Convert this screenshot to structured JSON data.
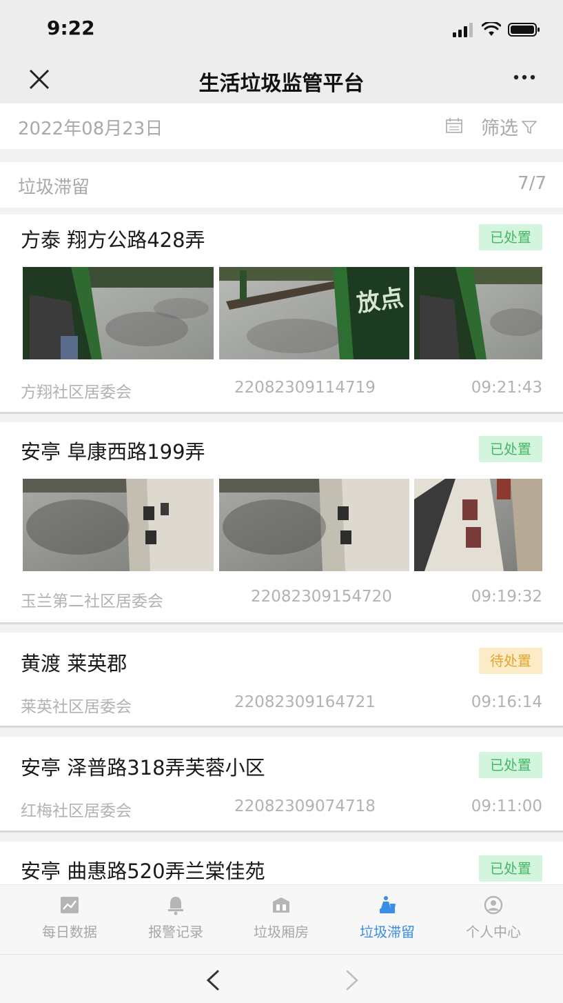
{
  "status_bar": {
    "time": "9:22"
  },
  "nav": {
    "title": "生活垃圾监管平台"
  },
  "date_bar": {
    "date": "2022年08月23日",
    "filter_label": "筛选"
  },
  "section": {
    "title": "垃圾滞留",
    "count": "7/7"
  },
  "records": [
    {
      "title": "方泰 翔方公路428弄",
      "status": "已处置",
      "committee": "方翔社区居委会",
      "id": "22082309114719",
      "time": "09:21:43",
      "photo_count": 3
    },
    {
      "title": "安亭 阜康西路199弄",
      "status": "已处置",
      "committee": "玉兰第二社区居委会",
      "id": "22082309154720",
      "time": "09:19:32",
      "photo_count": 3
    },
    {
      "title": "黄渡 莱英郡",
      "status": "待处置",
      "committee": "莱英社区居委会",
      "id": "22082309164721",
      "time": "09:16:14",
      "photo_count": 0
    },
    {
      "title": "安亭 泽普路318弄芙蓉小区",
      "status": "已处置",
      "committee": "红梅社区居委会",
      "id": "22082309074718",
      "time": "09:11:00",
      "photo_count": 0
    },
    {
      "title": "安亭 曲惠路520弄兰棠佳苑",
      "status": "已处置"
    }
  ],
  "photo_overlays": {
    "first_card_center": "放点"
  },
  "tabs": [
    {
      "label": "每日数据",
      "icon": "chart-icon"
    },
    {
      "label": "报警记录",
      "icon": "bell-icon"
    },
    {
      "label": "垃圾厢房",
      "icon": "trash-room-icon"
    },
    {
      "label": "垃圾滞留",
      "icon": "garbage-retention-icon",
      "active": true
    },
    {
      "label": "个人中心",
      "icon": "user-icon"
    }
  ],
  "colors": {
    "accent": "#3a8ee6",
    "done_bg": "#d4f5dd",
    "done_text": "#45b864",
    "pending_bg": "#fbecc7",
    "pending_text": "#e5a42c"
  }
}
